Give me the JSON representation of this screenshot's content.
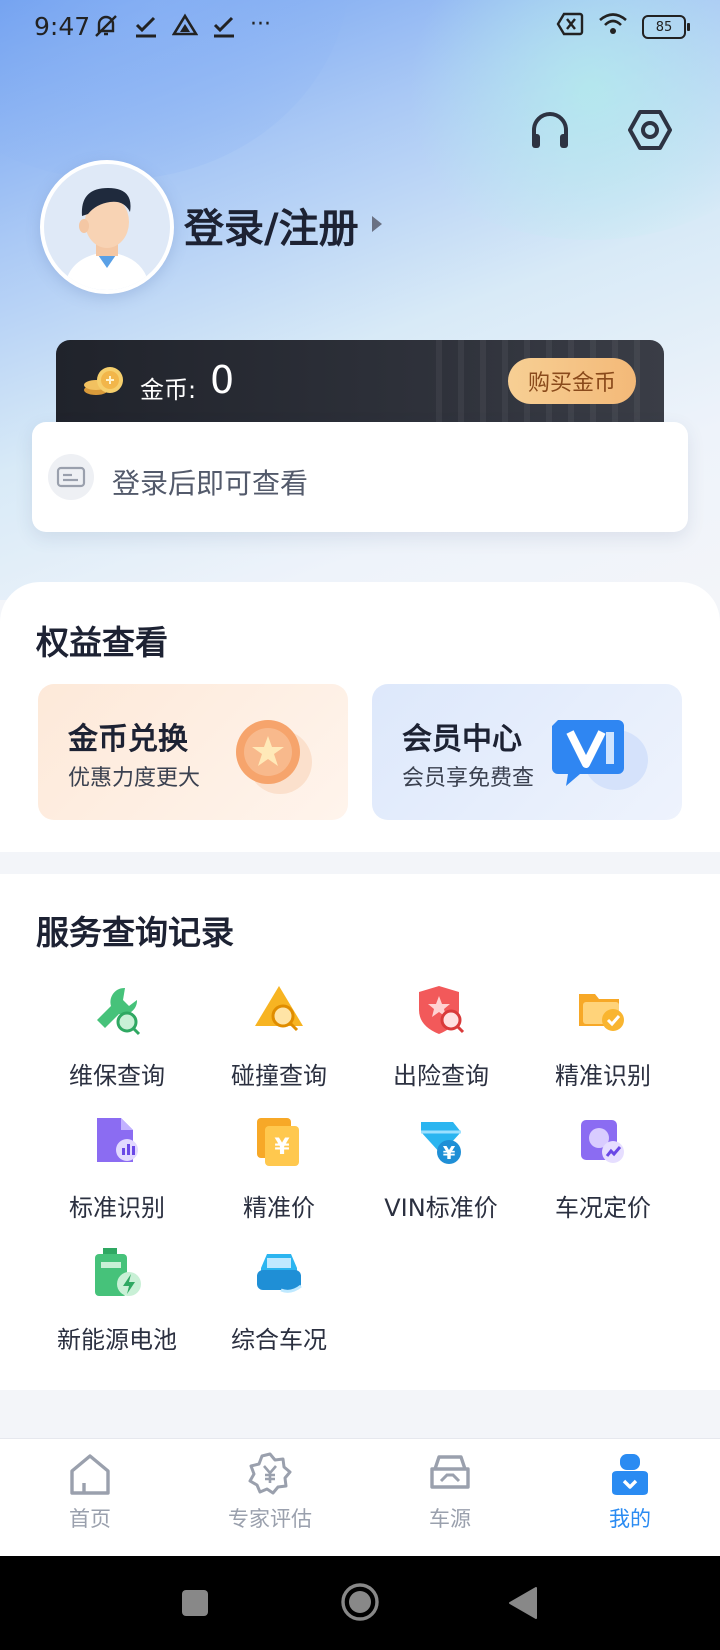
{
  "status": {
    "time": "9:47",
    "battery": "85",
    "more": "···"
  },
  "profile": {
    "login_label": "登录/注册"
  },
  "coins": {
    "label": "金币:",
    "value": "0",
    "buy_label": "购买金币"
  },
  "login_card": {
    "text": "登录后即可查看"
  },
  "rights": {
    "title": "权益查看",
    "cards": [
      {
        "title": "金币兑换",
        "subtitle": "优惠力度更大"
      },
      {
        "title": "会员中心",
        "subtitle": "会员享免费查"
      }
    ]
  },
  "services": {
    "title": "服务查询记录",
    "items": [
      {
        "label": "维保查询",
        "icon": "wrench-search-icon"
      },
      {
        "label": "碰撞查询",
        "icon": "collision-search-icon"
      },
      {
        "label": "出险查询",
        "icon": "insurance-search-icon"
      },
      {
        "label": "精准识别",
        "icon": "precise-recognition-icon"
      },
      {
        "label": "标准识别",
        "icon": "standard-recognition-icon"
      },
      {
        "label": "精准价",
        "icon": "precise-price-icon"
      },
      {
        "label": "VIN标准价",
        "icon": "vin-price-icon"
      },
      {
        "label": "车况定价",
        "icon": "condition-price-icon"
      },
      {
        "label": "新能源电池",
        "icon": "battery-icon"
      },
      {
        "label": "综合车况",
        "icon": "car-condition-icon"
      }
    ]
  },
  "tabs": [
    {
      "label": "首页",
      "icon": "home-icon"
    },
    {
      "label": "专家评估",
      "icon": "expert-evaluation-icon"
    },
    {
      "label": "车源",
      "icon": "car-source-icon"
    },
    {
      "label": "我的",
      "icon": "profile-icon",
      "active": true
    }
  ],
  "colors": {
    "accent": "#2a8bf2",
    "gold": "#f3b978",
    "dark": "#20232b"
  }
}
